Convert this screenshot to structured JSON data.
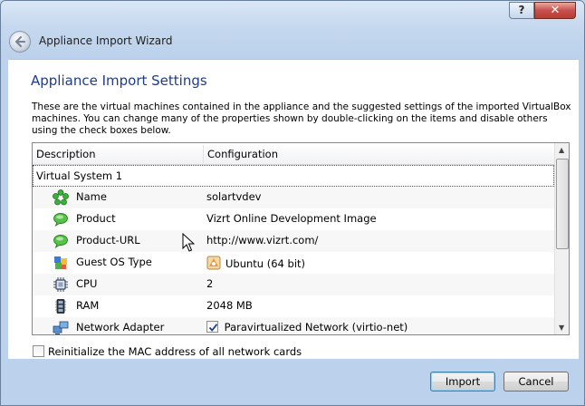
{
  "window": {
    "help_glyph": "?",
    "close_glyph": "✕",
    "title": "Appliance Import Wizard"
  },
  "page": {
    "heading": "Appliance Import Settings",
    "description": "These are the virtual machines contained in the appliance and the suggested settings of the imported VirtualBox machines. You can change many of the properties shown by double-clicking on the items and disable others using the check boxes below."
  },
  "tree": {
    "columns": [
      "Description",
      "Configuration"
    ],
    "group": "Virtual System 1",
    "rows": [
      {
        "label": "Name",
        "value": "solartvdev",
        "icon": "name-icon"
      },
      {
        "label": "Product",
        "value": "Vizrt Online Development Image",
        "icon": "speech-bubble-icon"
      },
      {
        "label": "Product-URL",
        "value": "http://www.vizrt.com/",
        "icon": "speech-bubble-icon"
      },
      {
        "label": "Guest OS Type",
        "value": "Ubuntu (64 bit)",
        "icon": "os-icon"
      },
      {
        "label": "CPU",
        "value": "2",
        "icon": "cpu-icon"
      },
      {
        "label": "RAM",
        "value": "2048 MB",
        "icon": "ram-icon"
      },
      {
        "label": "Network Adapter",
        "value": "Paravirtualized Network (virtio-net)",
        "icon": "network-icon",
        "checked": true
      }
    ]
  },
  "options": {
    "reinit_mac_label": "Reinitialize the MAC address of all network cards",
    "reinit_mac_checked": false
  },
  "buttons": {
    "import": "Import",
    "cancel": "Cancel"
  }
}
